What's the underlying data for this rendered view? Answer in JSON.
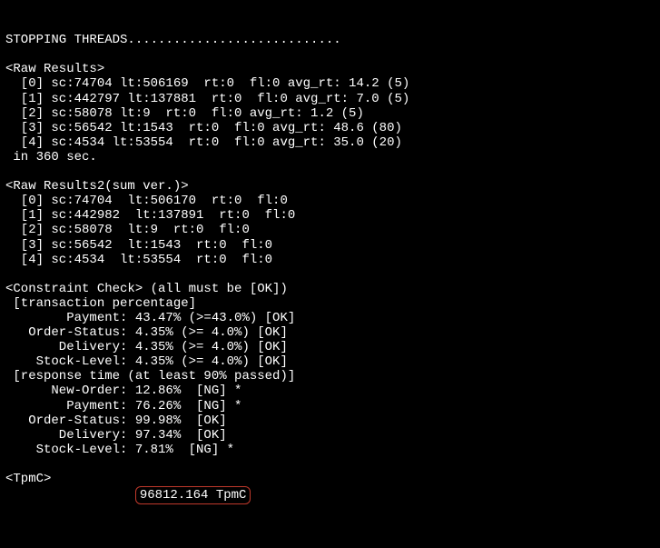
{
  "header": {
    "stopping": "STOPPING THREADS............................"
  },
  "raw_results": {
    "title": "<Raw Results>",
    "rows": [
      "  [0] sc:74704 lt:506169  rt:0  fl:0 avg_rt: 14.2 (5)",
      "  [1] sc:442797 lt:137881  rt:0  fl:0 avg_rt: 7.0 (5)",
      "  [2] sc:58078 lt:9  rt:0  fl:0 avg_rt: 1.2 (5)",
      "  [3] sc:56542 lt:1543  rt:0  fl:0 avg_rt: 48.6 (80)",
      "  [4] sc:4534 lt:53554  rt:0  fl:0 avg_rt: 35.0 (20)"
    ],
    "footer": " in 360 sec."
  },
  "raw_results2": {
    "title": "<Raw Results2(sum ver.)>",
    "rows": [
      "  [0] sc:74704  lt:506170  rt:0  fl:0",
      "  [1] sc:442982  lt:137891  rt:0  fl:0",
      "  [2] sc:58078  lt:9  rt:0  fl:0",
      "  [3] sc:56542  lt:1543  rt:0  fl:0",
      "  [4] sc:4534  lt:53554  rt:0  fl:0"
    ]
  },
  "constraint": {
    "title": "<Constraint Check> (all must be [OK])",
    "section1_title": " [transaction percentage]",
    "section1_rows": [
      "        Payment: 43.47% (>=43.0%) [OK]",
      "   Order-Status: 4.35% (>= 4.0%) [OK]",
      "       Delivery: 4.35% (>= 4.0%) [OK]",
      "    Stock-Level: 4.35% (>= 4.0%) [OK]"
    ],
    "section2_title": " [response time (at least 90% passed)]",
    "section2_rows": [
      "      New-Order: 12.86%  [NG] *",
      "        Payment: 76.26%  [NG] *",
      "   Order-Status: 99.98%  [OK]",
      "       Delivery: 97.34%  [OK]",
      "    Stock-Level: 7.81%  [NG] *"
    ]
  },
  "tpmc": {
    "title": "<TpmC>",
    "prefix": "                 ",
    "value": "96812.164 TpmC"
  }
}
